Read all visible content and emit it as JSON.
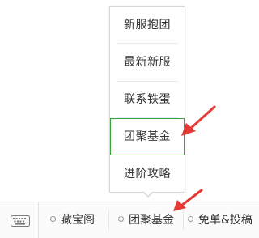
{
  "popup": {
    "items": [
      {
        "label": "新服抱团"
      },
      {
        "label": "最新新服"
      },
      {
        "label": "联系铁蛋"
      },
      {
        "label": "团聚基金"
      },
      {
        "label": "进阶攻略"
      }
    ],
    "highlight_color": "#3aa23a"
  },
  "menubar": {
    "keyboard_icon": "keyboard-icon",
    "items": [
      {
        "label": "藏宝阁"
      },
      {
        "label": "团聚基金"
      },
      {
        "label": "免单&投稿"
      }
    ]
  },
  "annotation": {
    "arrow_color": "#e53935"
  }
}
